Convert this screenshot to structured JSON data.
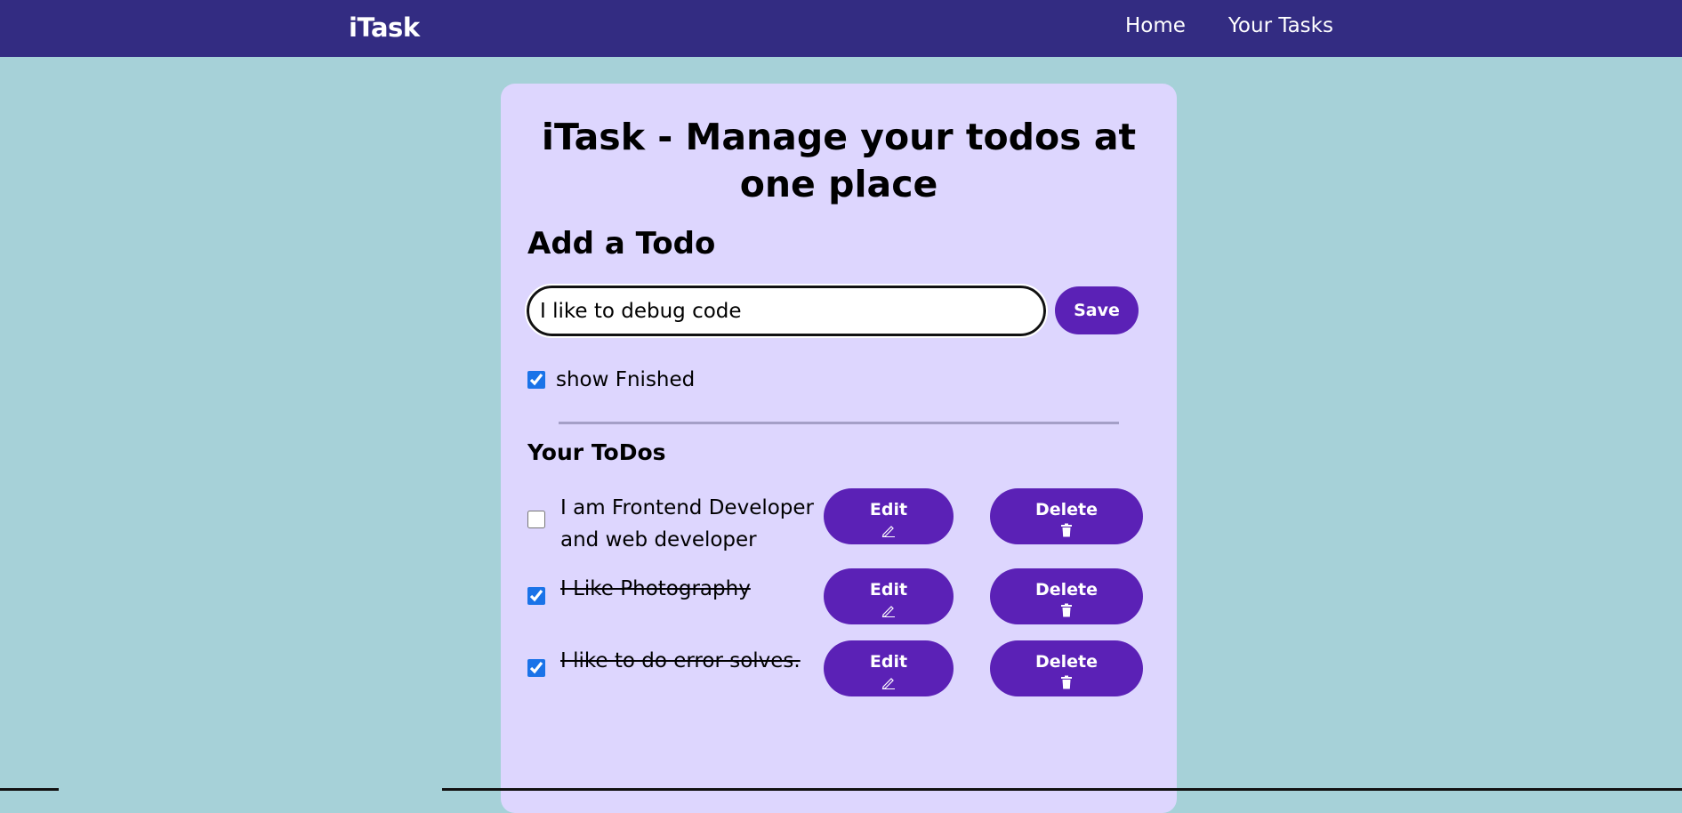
{
  "nav": {
    "brand": "iTask",
    "links": [
      "Home",
      "Your Tasks"
    ]
  },
  "main": {
    "title": "iTask - Manage your todos at one place",
    "add_heading": "Add a Todo",
    "input": {
      "value": "I like to debug code"
    },
    "save_label": "Save",
    "show_finished": {
      "label": "show Fnished",
      "checked": true
    },
    "todos_heading": "Your ToDos",
    "edit_label": "Edit",
    "delete_label": "Delete",
    "todos": [
      {
        "text": "I am Frontend Developer and web developer",
        "done": false
      },
      {
        "text": "I Like Photography",
        "done": true
      },
      {
        "text": "I like to do error solves.",
        "done": true
      }
    ]
  },
  "colors": {
    "navbar": "#332c82",
    "background": "#a6d1d8",
    "card": "#ddd6fe",
    "button": "#5b21b6",
    "checkbox": "#1a73e8"
  }
}
